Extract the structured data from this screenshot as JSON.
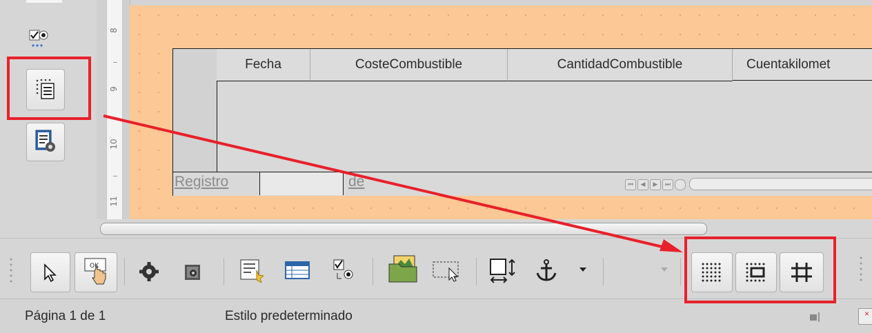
{
  "grid": {
    "columns": [
      "Fecha",
      "CosteCombustible",
      "CantidadCombustible",
      "Cuentakilomet"
    ],
    "nav_record_label": "Registro",
    "nav_of_label": "de"
  },
  "ruler": {
    "marks": [
      "8",
      "9",
      "10",
      "11"
    ]
  },
  "status_bar": {
    "page_info": "Página 1 de 1",
    "page_style": "Estilo predeterminado"
  },
  "colors": {
    "canvas": "#fcc895",
    "annotation": "#e8202a"
  },
  "icons": {
    "left_toolbar": [
      "checkbox-radio-icon",
      "form-navigator-icon",
      "form-properties-icon"
    ],
    "bottom_toolbar": [
      "select-pointer-icon",
      "design-mode-icon",
      "control-properties-icon",
      "form-properties-icon",
      "form-wizard-icon",
      "table-control-icon",
      "checkbox-icon",
      "image-control-icon",
      "group-select-icon",
      "position-size-icon",
      "anchor-icon",
      "display-grid-icon",
      "snap-to-grid-icon",
      "helplines-while-moving-icon"
    ]
  }
}
